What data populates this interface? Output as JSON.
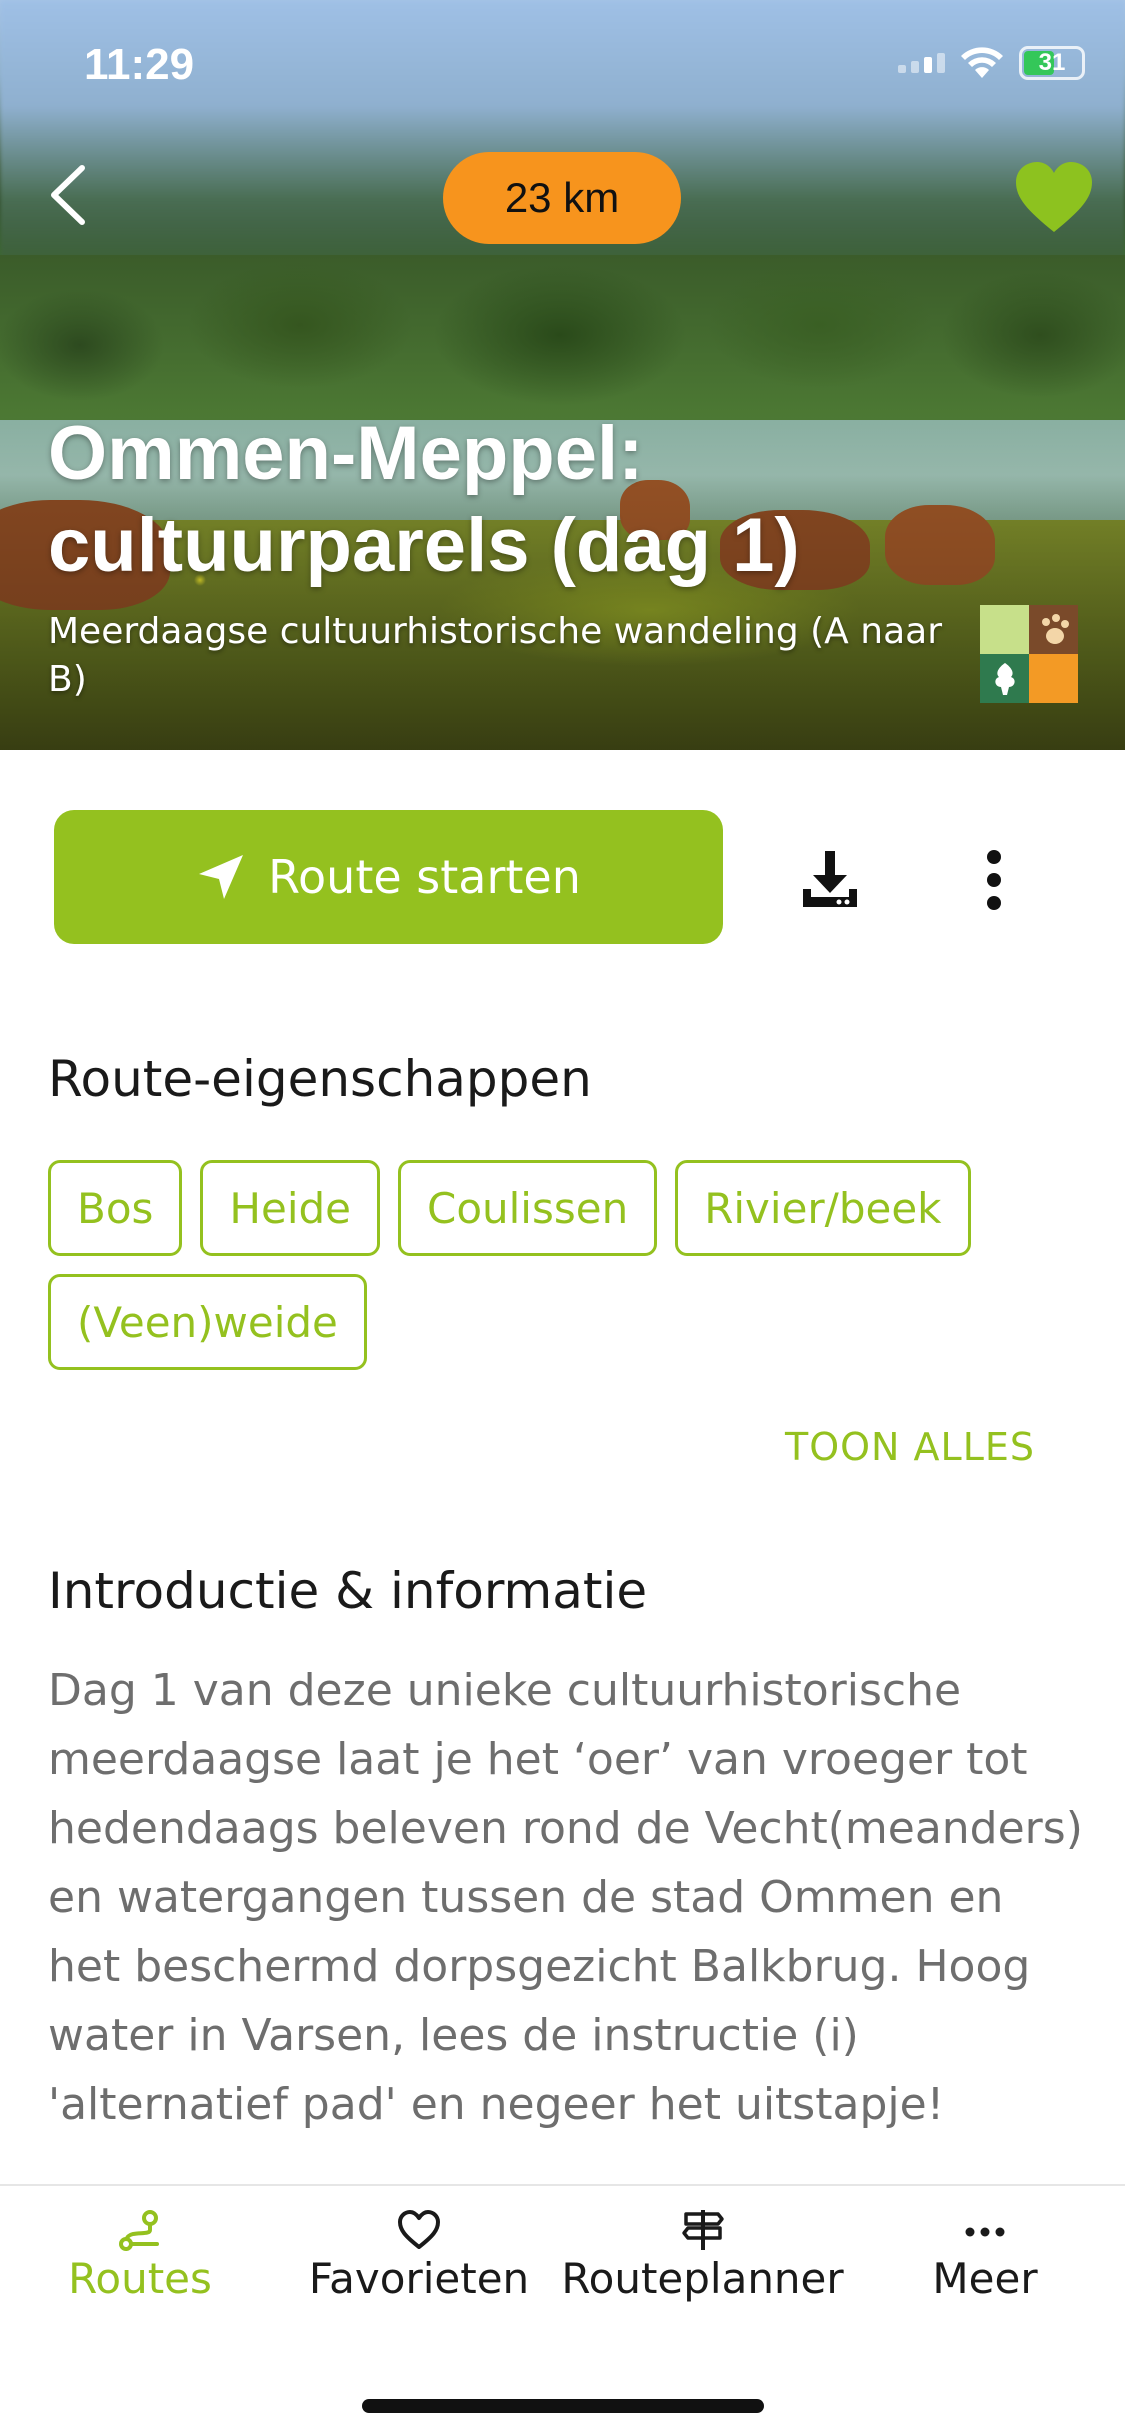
{
  "status_bar": {
    "time": "11:29",
    "battery": "31"
  },
  "header": {
    "distance": "23 km"
  },
  "hero": {
    "title": "Ommen-Meppel: cultuurparels (dag 1)",
    "subtitle": "Meerdaagse cultuurhistorische wandeling (A naar B)"
  },
  "actions": {
    "start_label": "Route starten",
    "start_icon": "navigation-arrow-icon",
    "download_icon": "download-icon",
    "more_icon": "more-vertical-icon"
  },
  "properties": {
    "title": "Route-eigenschappen",
    "tags": [
      "Bos",
      "Heide",
      "Coulissen",
      "Rivier/beek",
      "(Veen)weide"
    ],
    "show_all": "TOON ALLES"
  },
  "intro": {
    "title": "Introductie & informatie",
    "text": "Dag 1 van deze unieke cultuurhistorische meerdaagse laat je het ‘oer’ van vroeger tot hedendaags beleven rond de Vecht(meanders) en watergangen tussen de stad Ommen en het beschermd dorpsgezicht Balkbrug. Hoog water in Varsen, lees de instructie (i) 'alternatief pad' en negeer het uitstapje!"
  },
  "tabbar": {
    "items": [
      {
        "label": "Routes",
        "icon": "route-icon",
        "active": true
      },
      {
        "label": "Favorieten",
        "icon": "heart-outline-icon",
        "active": false
      },
      {
        "label": "Routeplanner",
        "icon": "signpost-icon",
        "active": false
      },
      {
        "label": "Meer",
        "icon": "more-horizontal-icon",
        "active": false
      }
    ]
  },
  "colors": {
    "accent": "#94c11f",
    "distance_pill": "#f7941d",
    "text": "#1a1a1a",
    "muted": "#6e6e6e"
  }
}
